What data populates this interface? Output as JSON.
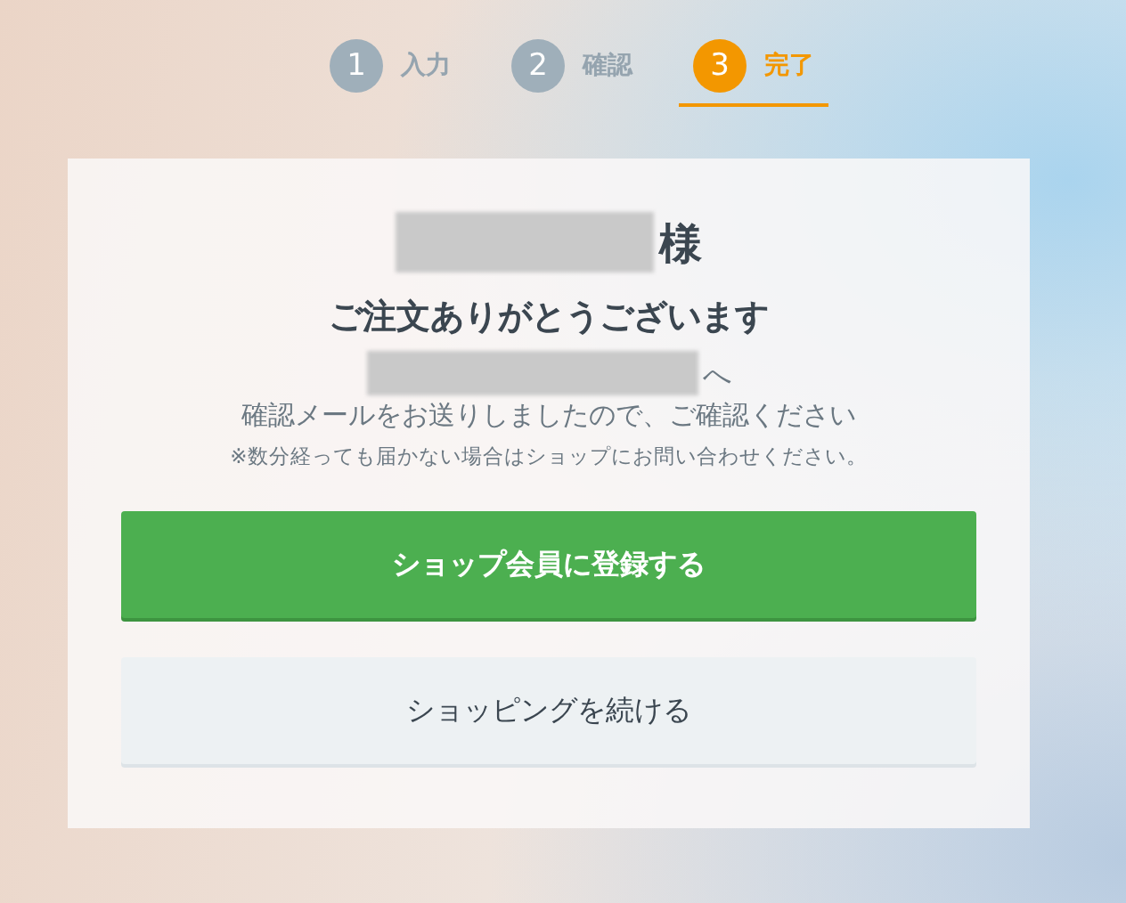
{
  "steps": [
    {
      "number": "1",
      "label": "入力",
      "selected": false
    },
    {
      "number": "2",
      "label": "確認",
      "selected": false
    },
    {
      "number": "3",
      "label": "完了",
      "selected": true
    }
  ],
  "card": {
    "name_suffix": "様",
    "title": "ご注文ありがとうございます",
    "email_suffix": "へ",
    "message": "確認メールをお送りしましたので、ご確認ください",
    "note": "※数分経っても届かない場合はショップにお問い合わせください。",
    "buttons": [
      {
        "kind": "primary",
        "label": "ショップ会員に登録する"
      },
      {
        "kind": "secondary",
        "label": "ショッピングを続ける"
      }
    ]
  }
}
